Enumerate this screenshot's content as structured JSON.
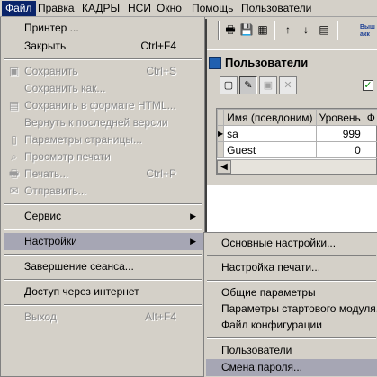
{
  "menubar": {
    "items": [
      "Файл",
      "Правка",
      "КАДРЫ",
      "НСИ",
      "Окно",
      "Помощь",
      "Пользователи"
    ]
  },
  "toolbar": {
    "brand_text": [
      "Выш",
      "акк"
    ],
    "icons": [
      "printer-icon",
      "save-icon",
      "disk-icon",
      "sort-asc-icon",
      "sort-desc-icon",
      "table-icon"
    ]
  },
  "document": {
    "title": "Пользователи",
    "grid": {
      "columns": [
        "Имя (псевдоним)",
        "Уровень",
        "Ф"
      ],
      "rows": [
        {
          "name": "sa",
          "level": "999",
          "current": true
        },
        {
          "name": "Guest",
          "level": "0",
          "current": false
        }
      ]
    }
  },
  "file_menu": {
    "items": [
      {
        "label": "Принтер ...",
        "shortcut": "",
        "disabled": false
      },
      {
        "label": "Закрыть",
        "shortcut": "Ctrl+F4",
        "disabled": false
      },
      {
        "label": "Сохранить",
        "shortcut": "Ctrl+S",
        "disabled": true
      },
      {
        "label": "Сохранить как...",
        "shortcut": "",
        "disabled": true
      },
      {
        "label": "Сохранить в формате HTML...",
        "shortcut": "",
        "disabled": true
      },
      {
        "label": "Вернуть к последней версии",
        "shortcut": "",
        "disabled": true
      },
      {
        "label": "Параметры страницы...",
        "shortcut": "",
        "disabled": true
      },
      {
        "label": "Просмотр печати",
        "shortcut": "",
        "disabled": true
      },
      {
        "label": "Печать...",
        "shortcut": "Ctrl+P",
        "disabled": true
      },
      {
        "label": "Отправить...",
        "shortcut": "",
        "disabled": true
      },
      {
        "label": "Сервис",
        "shortcut": "",
        "disabled": false
      },
      {
        "label": "Настройки",
        "shortcut": "",
        "disabled": false
      },
      {
        "label": "Завершение сеанса...",
        "shortcut": "",
        "disabled": false
      },
      {
        "label": "Доступ через интернет",
        "shortcut": "",
        "disabled": false
      },
      {
        "label": "Выход",
        "shortcut": "Alt+F4",
        "disabled": true
      }
    ]
  },
  "settings_submenu": {
    "items": [
      "Основные настройки...",
      "Настройка печати...",
      "Общие параметры",
      "Параметры стартового модуля...",
      "Файл конфигурации",
      "Пользователи",
      "Смена пароля..."
    ]
  }
}
